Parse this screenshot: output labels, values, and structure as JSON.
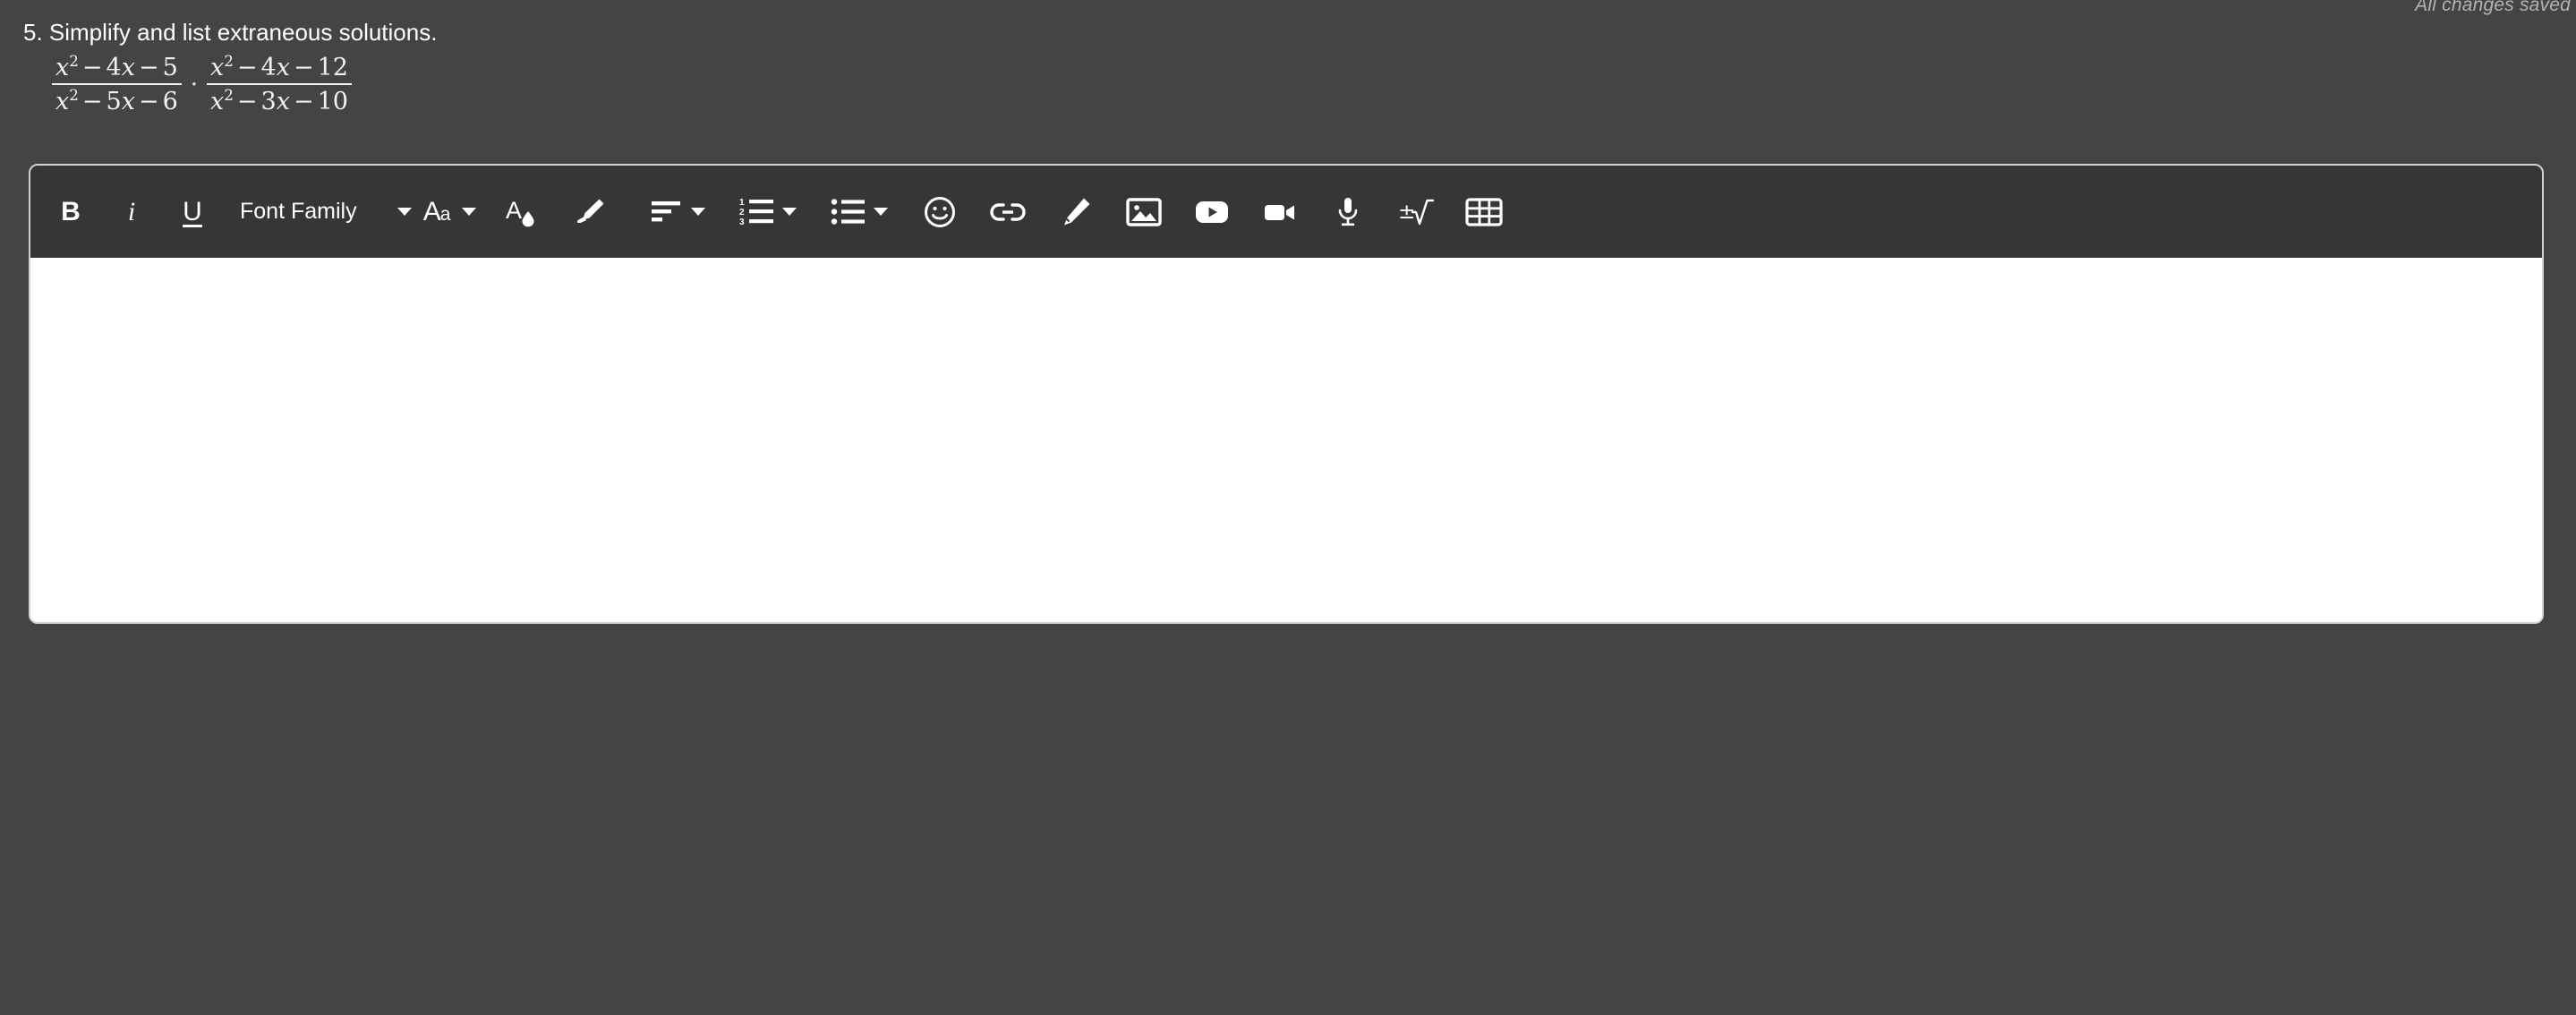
{
  "status": {
    "saved_text": "All changes saved"
  },
  "question": {
    "number": "5.",
    "prompt": "5. Simplify and list extraneous solutions.",
    "expression_plain": "(x^2 - 4x - 5)/(x^2 - 5x - 6) . (x^2 - 4x - 12)/(x^2 - 3x - 10)",
    "fraction1": {
      "numerator": {
        "var": "x",
        "exp": "2",
        "op1": "−",
        "coef": "4",
        "var2": "x",
        "op2": "−",
        "constant": "5"
      },
      "denominator": {
        "var": "x",
        "exp": "2",
        "op1": "−",
        "coef": "5",
        "var2": "x",
        "op2": "−",
        "constant": "6"
      }
    },
    "operator": "·",
    "fraction2": {
      "numerator": {
        "var": "x",
        "exp": "2",
        "op1": "−",
        "coef": "4",
        "var2": "x",
        "op2": "−",
        "constant": "12"
      },
      "denominator": {
        "var": "x",
        "exp": "2",
        "op1": "−",
        "coef": "3",
        "var2": "x",
        "op2": "−",
        "constant": "10"
      }
    }
  },
  "editor": {
    "content_value": "",
    "content_placeholder": "",
    "toolbar": {
      "bold_label": "B",
      "italic_label": "i",
      "underline_label": "U",
      "font_family_label": "Font Family",
      "font_size_label_large": "A",
      "font_size_label_small": "a",
      "icons": [
        "bold-icon",
        "italic-icon",
        "underline-icon",
        "font-family-dropdown",
        "font-family-caret-icon",
        "font-size-icon",
        "font-size-caret-icon",
        "text-color-icon",
        "highlighter-icon",
        "align-icon",
        "align-caret-icon",
        "numbered-list-icon",
        "numbered-list-caret-icon",
        "bullet-list-icon",
        "bullet-list-caret-icon",
        "emoji-icon",
        "link-icon",
        "draw-icon",
        "image-icon",
        "youtube-icon",
        "video-icon",
        "microphone-icon",
        "math-equation-icon",
        "table-icon"
      ]
    }
  },
  "colors": {
    "page_background": "#444444",
    "toolbar_background": "#363636",
    "editor_background": "#ffffff",
    "editor_border": "#d0d0d0",
    "text_primary": "#ffffff",
    "status_text": "#b3b3b3"
  }
}
